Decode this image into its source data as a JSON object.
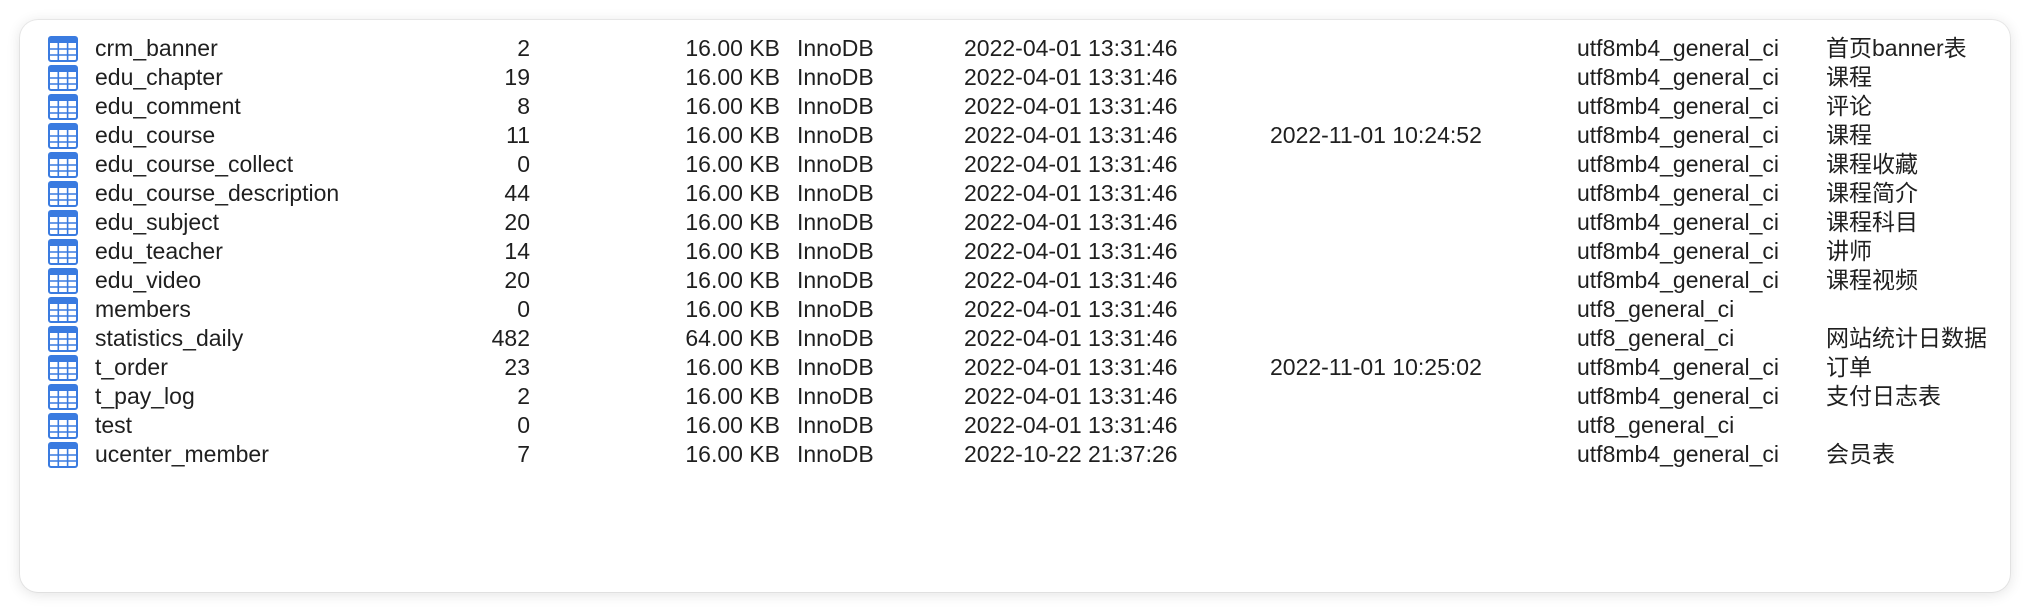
{
  "colors": {
    "icon_blue": "#3a7be0",
    "icon_header": "#2f6fd6",
    "text": "#1f1f1f"
  },
  "table_icon": "table-icon",
  "tables": [
    {
      "name": "crm_banner",
      "rows": "2",
      "size": "16.00 KB",
      "engine": "InnoDB",
      "created": "2022-04-01 13:31:46",
      "updated": "",
      "collation": "utf8mb4_general_ci",
      "comment": "首页banner表"
    },
    {
      "name": "edu_chapter",
      "rows": "19",
      "size": "16.00 KB",
      "engine": "InnoDB",
      "created": "2022-04-01 13:31:46",
      "updated": "",
      "collation": "utf8mb4_general_ci",
      "comment": "课程"
    },
    {
      "name": "edu_comment",
      "rows": "8",
      "size": "16.00 KB",
      "engine": "InnoDB",
      "created": "2022-04-01 13:31:46",
      "updated": "",
      "collation": "utf8mb4_general_ci",
      "comment": "评论"
    },
    {
      "name": "edu_course",
      "rows": "11",
      "size": "16.00 KB",
      "engine": "InnoDB",
      "created": "2022-04-01 13:31:46",
      "updated": "2022-11-01 10:24:52",
      "collation": "utf8mb4_general_ci",
      "comment": "课程"
    },
    {
      "name": "edu_course_collect",
      "rows": "0",
      "size": "16.00 KB",
      "engine": "InnoDB",
      "created": "2022-04-01 13:31:46",
      "updated": "",
      "collation": "utf8mb4_general_ci",
      "comment": "课程收藏"
    },
    {
      "name": "edu_course_description",
      "rows": "44",
      "size": "16.00 KB",
      "engine": "InnoDB",
      "created": "2022-04-01 13:31:46",
      "updated": "",
      "collation": "utf8mb4_general_ci",
      "comment": "课程简介"
    },
    {
      "name": "edu_subject",
      "rows": "20",
      "size": "16.00 KB",
      "engine": "InnoDB",
      "created": "2022-04-01 13:31:46",
      "updated": "",
      "collation": "utf8mb4_general_ci",
      "comment": "课程科目"
    },
    {
      "name": "edu_teacher",
      "rows": "14",
      "size": "16.00 KB",
      "engine": "InnoDB",
      "created": "2022-04-01 13:31:46",
      "updated": "",
      "collation": "utf8mb4_general_ci",
      "comment": "讲师"
    },
    {
      "name": "edu_video",
      "rows": "20",
      "size": "16.00 KB",
      "engine": "InnoDB",
      "created": "2022-04-01 13:31:46",
      "updated": "",
      "collation": "utf8mb4_general_ci",
      "comment": "课程视频"
    },
    {
      "name": "members",
      "rows": "0",
      "size": "16.00 KB",
      "engine": "InnoDB",
      "created": "2022-04-01 13:31:46",
      "updated": "",
      "collation": "utf8_general_ci",
      "comment": ""
    },
    {
      "name": "statistics_daily",
      "rows": "482",
      "size": "64.00 KB",
      "engine": "InnoDB",
      "created": "2022-04-01 13:31:46",
      "updated": "",
      "collation": "utf8_general_ci",
      "comment": "网站统计日数据"
    },
    {
      "name": "t_order",
      "rows": "23",
      "size": "16.00 KB",
      "engine": "InnoDB",
      "created": "2022-04-01 13:31:46",
      "updated": "2022-11-01 10:25:02",
      "collation": "utf8mb4_general_ci",
      "comment": "订单"
    },
    {
      "name": "t_pay_log",
      "rows": "2",
      "size": "16.00 KB",
      "engine": "InnoDB",
      "created": "2022-04-01 13:31:46",
      "updated": "",
      "collation": "utf8mb4_general_ci",
      "comment": "支付日志表"
    },
    {
      "name": "test",
      "rows": "0",
      "size": "16.00 KB",
      "engine": "InnoDB",
      "created": "2022-04-01 13:31:46",
      "updated": "",
      "collation": "utf8_general_ci",
      "comment": ""
    },
    {
      "name": "ucenter_member",
      "rows": "7",
      "size": "16.00 KB",
      "engine": "InnoDB",
      "created": "2022-10-22 21:37:26",
      "updated": "",
      "collation": "utf8mb4_general_ci",
      "comment": "会员表"
    }
  ]
}
